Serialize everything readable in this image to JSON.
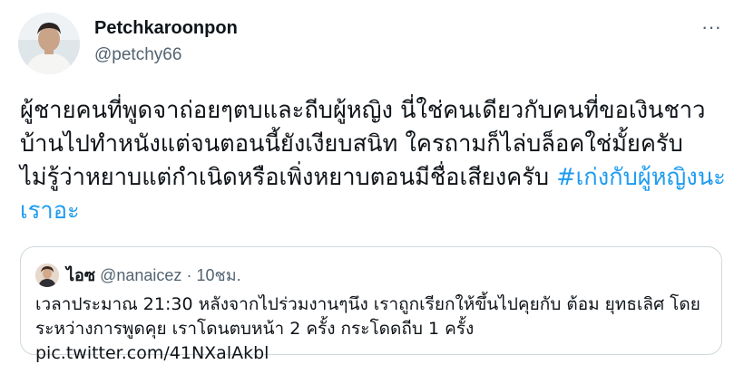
{
  "tweet": {
    "author": {
      "display_name": "Petchkaroonpon",
      "handle": "@petchy66"
    },
    "more_icon": "more-dots-icon",
    "more_label": "···",
    "text": "ผู้ชายคนที่พูดจาถ่อยๆตบและถีบผู้หญิง นี่ใช่คนเดียวกับคนที่ขอเงินชาวบ้านไปทำหนังแต่จนตอนนี้ยังเงียบสนิท ใครถามก็ไล่บล็อคใช่มั้ยครับ ไม่รู้ว่าหยาบแต่กำเนิดหรือเพิ่งหยาบตอนมีชื่อเสียงครับ",
    "hashtag": "#เก่งกับผู้หญิงนะเราอะ",
    "colors": {
      "hashtag": "#1d9bf0",
      "secondary": "#536471",
      "border": "#cfd9de"
    }
  },
  "quoted": {
    "display_name": "ไอซ",
    "handle": "@nanaicez",
    "separator": "·",
    "time": "10ชม.",
    "text": "เวลาประมาณ 21:30 หลังจากไปร่วมงานๆนึง เราถูกเรียกให้ขึ้นไปคุยกับ ต้อม ยุทธเลิศ โดยระหว่างการพูดคุย เราโดนตบหน้า 2 ครั้ง กระโดดถีบ 1 ครั้ง pic.twitter.com/41NXalAkbl"
  }
}
